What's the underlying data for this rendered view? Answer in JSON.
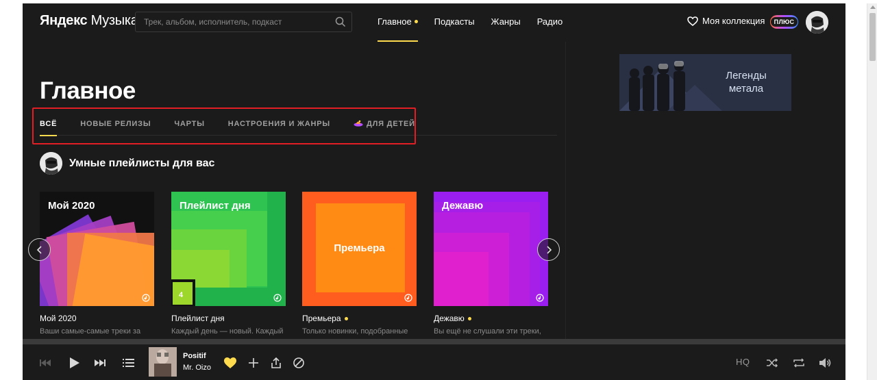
{
  "header": {
    "logo_bold": "Яндекс",
    "logo_light": "Музыка",
    "search_placeholder": "Трек, альбом, исполнитель, подкаст",
    "nav": [
      {
        "label": "Главное",
        "active": true,
        "dot": true
      },
      {
        "label": "Подкасты",
        "active": false
      },
      {
        "label": "Жанры",
        "active": false
      },
      {
        "label": "Радио",
        "active": false
      }
    ],
    "collection_label": "Моя коллекция",
    "plus_label": "ПЛЮС"
  },
  "main": {
    "title": "Главное",
    "tabs": [
      {
        "label": "ВСЁ",
        "active": true
      },
      {
        "label": "НОВЫЕ РЕЛИЗЫ",
        "active": false
      },
      {
        "label": "ЧАРТЫ",
        "active": false
      },
      {
        "label": "НАСТРОЕНИЯ И ЖАНРЫ",
        "active": false
      },
      {
        "label": "ДЛЯ ДЕТЕЙ",
        "active": false,
        "icon": "kids-ufo-icon"
      }
    ],
    "section_title": "Умные плейлисты для вас",
    "cards": [
      {
        "cover_title": "Мой 2020",
        "name": "Мой 2020",
        "desc": "Ваши самые-самые треки за",
        "dot": false
      },
      {
        "cover_title": "Плейлист дня",
        "cover_number": "4",
        "name": "Плейлист дня",
        "desc": "Каждый день — новый. Каждый",
        "dot": false
      },
      {
        "cover_title": "Премьера",
        "name": "Премьера",
        "desc": "Только новинки, подобранные",
        "dot": true
      },
      {
        "cover_title": "Дежавю",
        "name": "Дежавю",
        "desc": "Вы ещё не слушали эти треки,",
        "dot": true
      }
    ]
  },
  "sidebar": {
    "banner_text": "Легенды металa"
  },
  "player": {
    "track_title": "Positif",
    "track_artist": "Mr. Oizo",
    "quality_label": "HQ"
  },
  "colors": {
    "accent": "#ffdb4d",
    "background": "#1b1b1b",
    "highlight": "#e31e24"
  }
}
